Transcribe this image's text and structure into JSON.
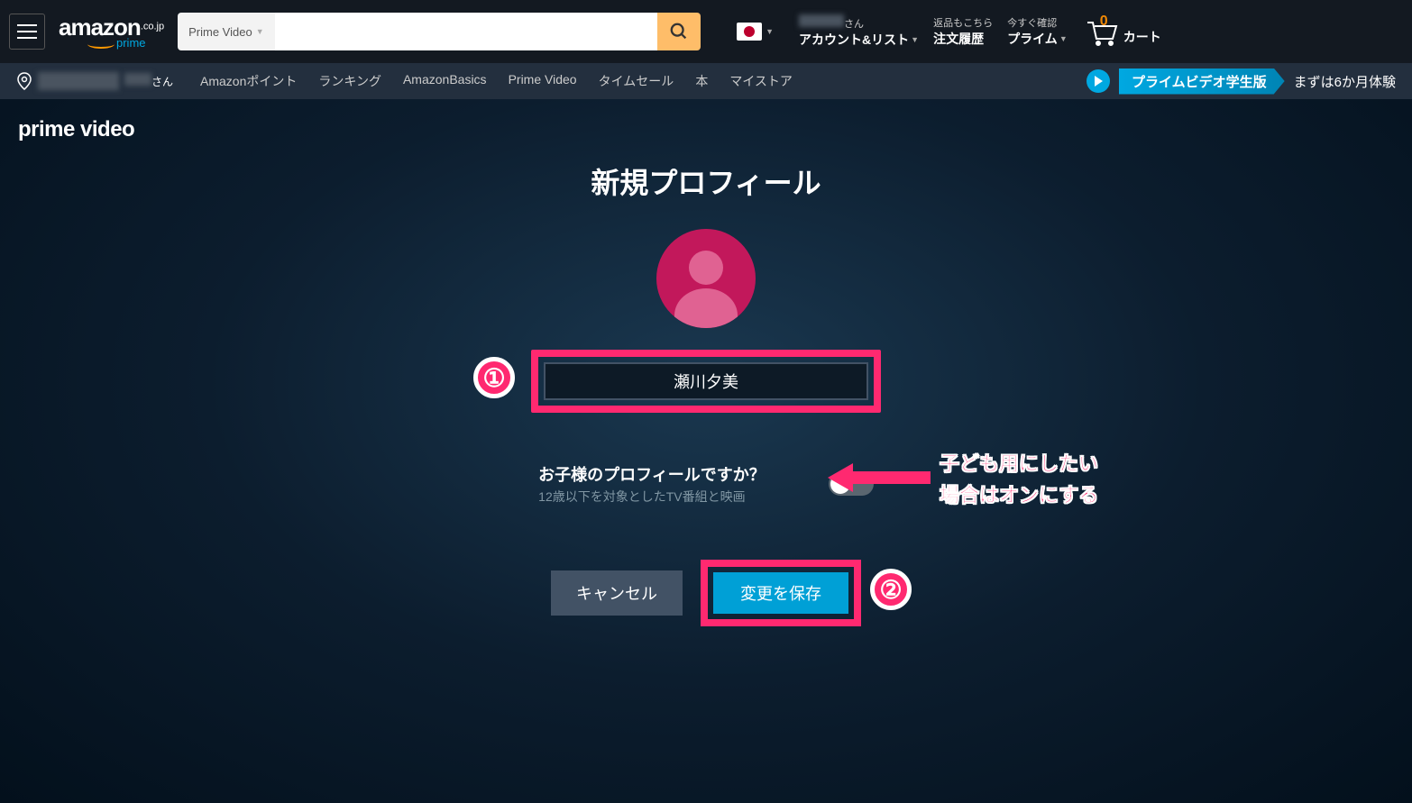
{
  "header": {
    "logo_text": "amazon",
    "logo_suffix": ".co.jp",
    "logo_prime": "prime",
    "search_category": "Prime Video",
    "search_value": "",
    "account_suffix": "さん",
    "account_label": "アカウント&リスト",
    "returns_sub": "返品もこちら",
    "returns_main": "注文履歴",
    "prime_sub": "今すぐ確認",
    "prime_main": "プライム",
    "cart_count": "0",
    "cart_label": "カート"
  },
  "subnav": {
    "deliver_suffix": "さん",
    "links": [
      "Amazonポイント",
      "ランキング",
      "AmazonBasics",
      "Prime Video",
      "タイムセール",
      "本",
      "マイストア"
    ],
    "promo_banner": "プライムビデオ学生版",
    "promo_text": "まずは6か月体験"
  },
  "content": {
    "pv_logo": "prime video",
    "title": "新規プロフィール",
    "name_value": "瀬川夕美",
    "kids_title": "お子様のプロフィールですか？",
    "kids_sub": "12歳以下を対象としたTV番組と映画",
    "cancel": "キャンセル",
    "save": "変更を保存",
    "badge1": "①",
    "badge2": "②",
    "annotation_line1": "子ども用にしたい",
    "annotation_line2": "場合はオンにする"
  }
}
